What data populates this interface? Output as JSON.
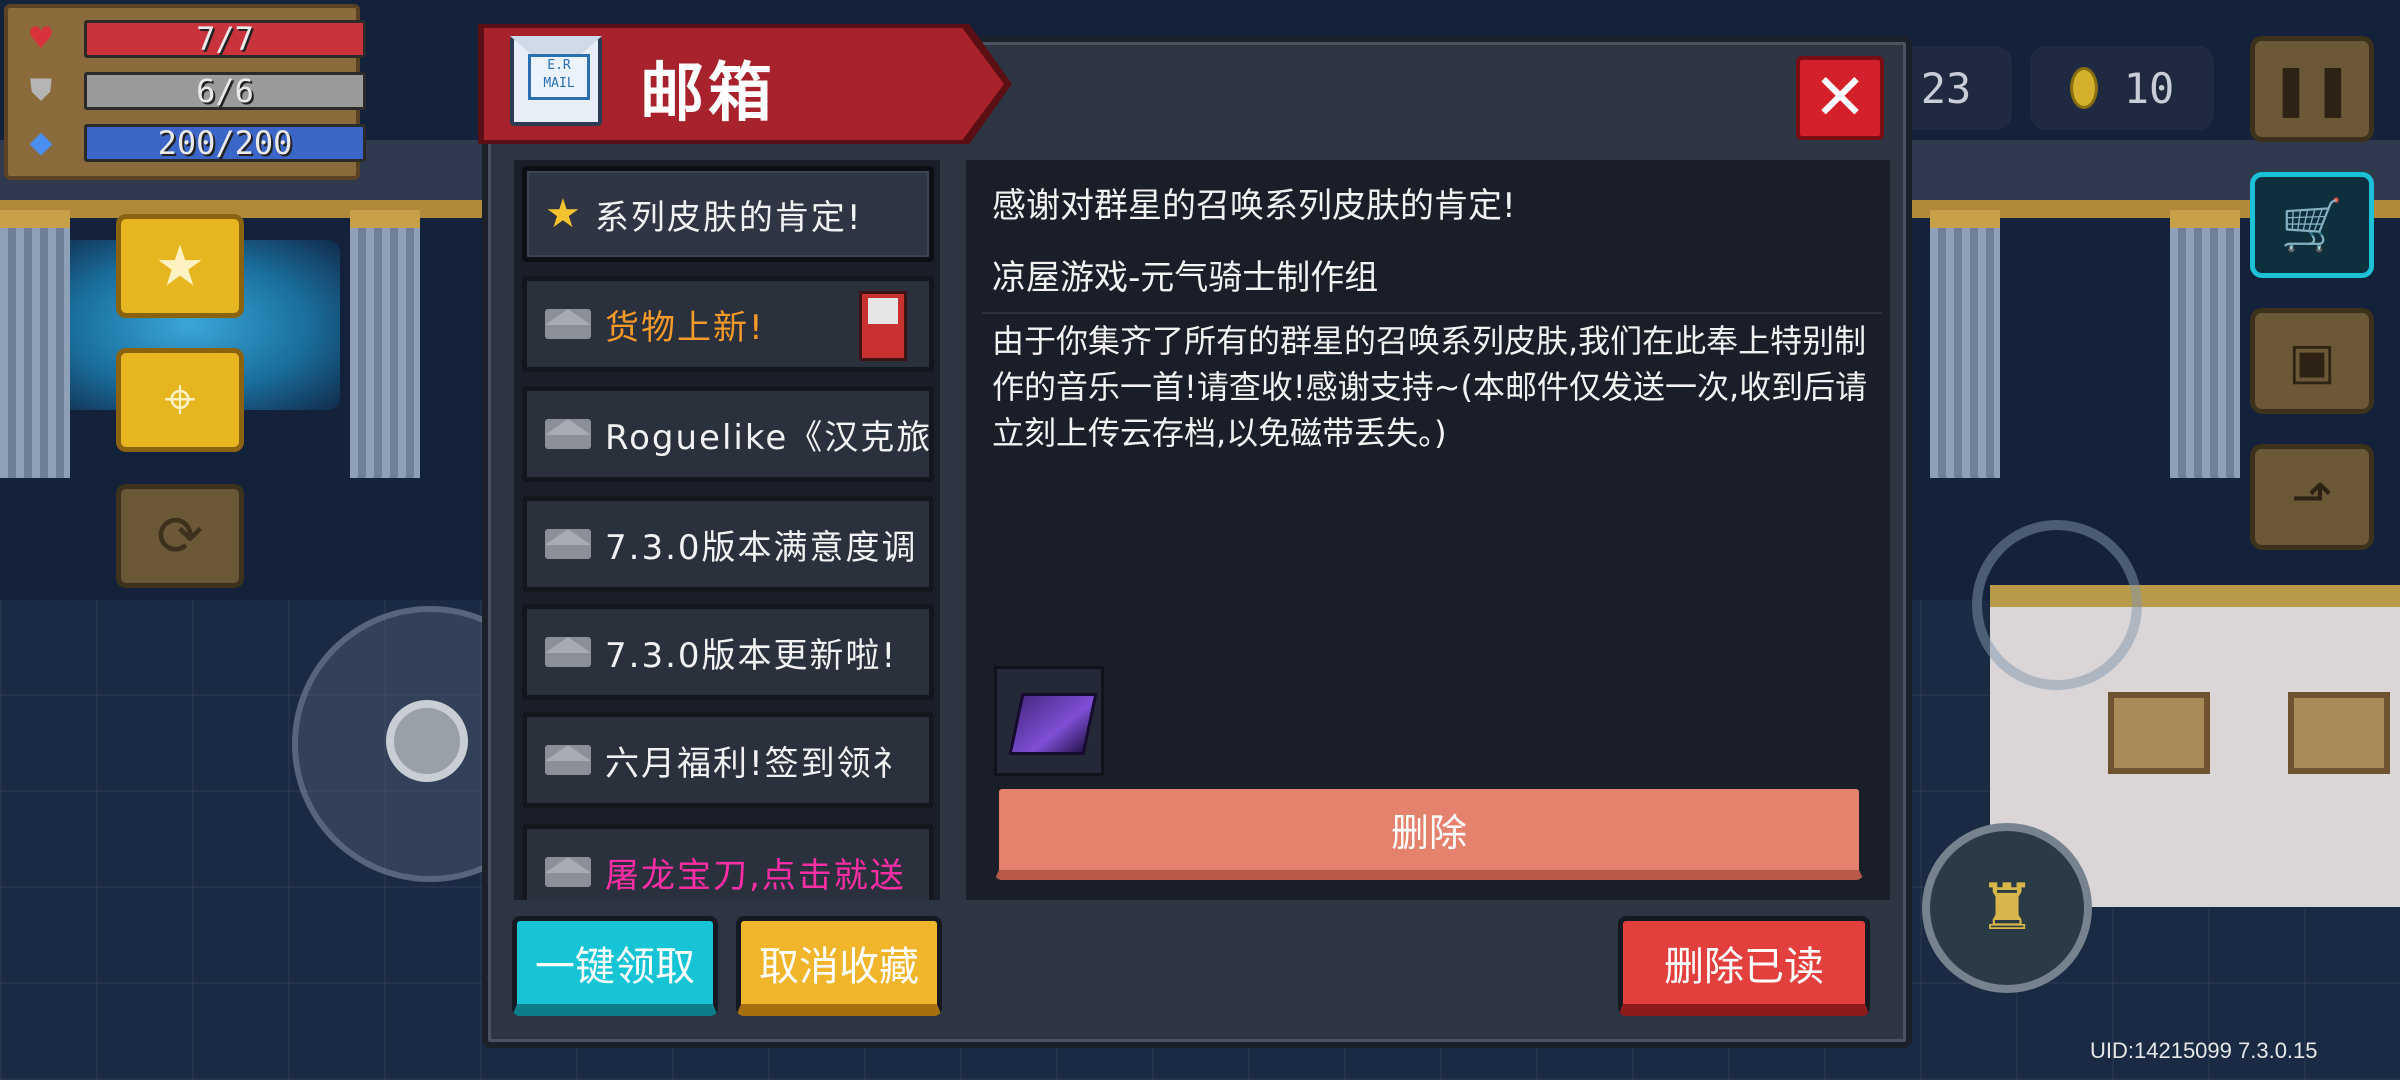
{
  "hud": {
    "health": {
      "text": "7/7",
      "fill": 1.0,
      "color": "#c9333c"
    },
    "armor": {
      "text": "6/6",
      "fill": 1.0,
      "color": "#9a9a9a"
    },
    "energy": {
      "text": "200/200",
      "fill": 1.0,
      "color": "#3b66c8"
    },
    "gem_count_partial": "23",
    "coin_count": "10",
    "uid": "UID:14215099 7.3.0.15"
  },
  "dialog": {
    "title": "邮箱",
    "stamp_text": "E.R\nMAIL",
    "close_glyph": "✕"
  },
  "mail_list": [
    {
      "label": "系列皮肤的肯定!",
      "color": "white",
      "starred": true,
      "selected": true
    },
    {
      "label": "货物上新!",
      "color": "orange",
      "starred": false,
      "has_item_icon": true
    },
    {
      "label": "Roguelike《汉克旅",
      "color": "white",
      "starred": false
    },
    {
      "label": "7.3.0版本满意度调",
      "color": "white",
      "starred": false
    },
    {
      "label": "7.3.0版本更新啦!",
      "color": "white",
      "starred": false
    },
    {
      "label": "六月福利!签到领礻",
      "color": "white",
      "starred": false
    },
    {
      "label": "屠龙宝刀,点击就送",
      "color": "magenta",
      "starred": false
    }
  ],
  "mail_content": {
    "subject": "感谢对群星的召唤系列皮肤的肯定!",
    "sender": "凉屋游戏-元气骑士制作组",
    "body": "由于你集齐了所有的群星的召唤系列皮肤,我们在此奉上特别制作的音乐一首!请查收!感谢支持~(本邮件仅发送一次,收到后请立刻上传云存档,以免磁带丢失。)",
    "delete_label": "删除"
  },
  "buttons": {
    "claim_all": "一键领取",
    "unfavorite": "取消收藏",
    "delete_read": "删除已读"
  },
  "colors": {
    "banner": "#a8222b",
    "claim": "#16c4d6",
    "unfavorite": "#f0b52a",
    "delete_read": "#e2403d",
    "delete": "#e5826d"
  }
}
